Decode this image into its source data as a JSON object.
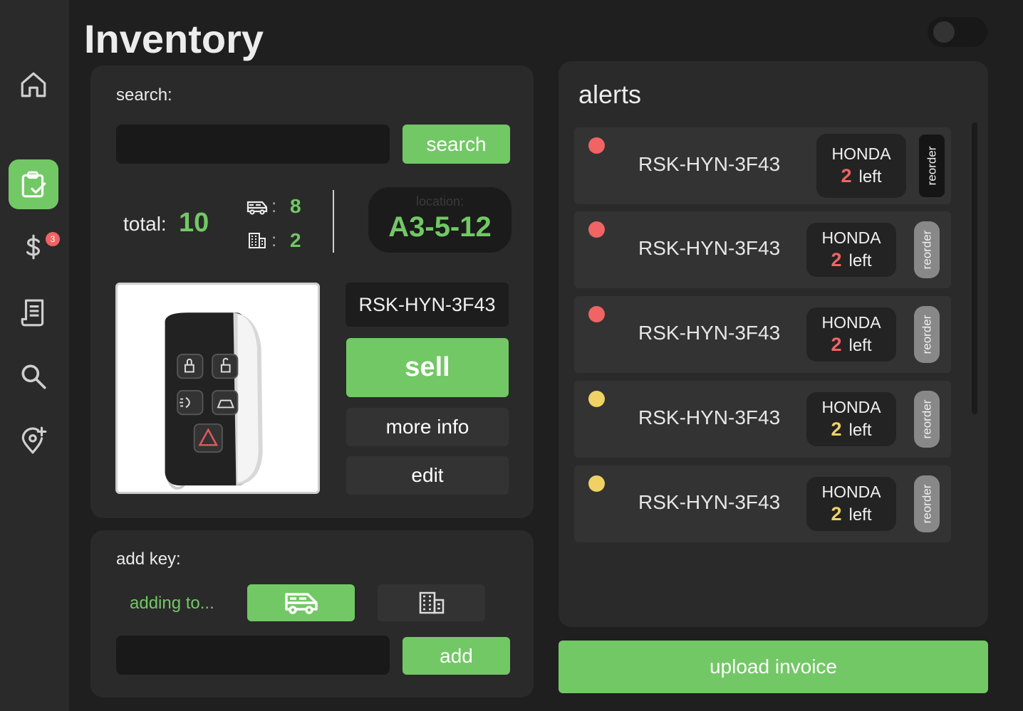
{
  "app": {
    "title": "Inventory"
  },
  "sidebar": {
    "items": [
      {
        "name": "home",
        "icon": "home-icon"
      },
      {
        "name": "inventory",
        "icon": "clipboard-check-icon",
        "active": true
      },
      {
        "name": "sales",
        "icon": "dollar-icon",
        "badge": "3"
      },
      {
        "name": "receipts",
        "icon": "receipt-icon"
      },
      {
        "name": "search",
        "icon": "search-icon"
      },
      {
        "name": "add-location",
        "icon": "location-plus-icon"
      }
    ]
  },
  "search_panel": {
    "label": "search:",
    "input_value": "",
    "button_label": "search",
    "total_label": "total:",
    "total_value": "10",
    "van_sep": ":",
    "van_count": "8",
    "building_sep": ":",
    "building_count": "2",
    "location_label": "location:",
    "location_value": "A3-5-12",
    "key_code": "RSK-HYN-3F43",
    "sell_label": "sell",
    "more_info_label": "more info",
    "edit_label": "edit"
  },
  "add_panel": {
    "label": "add key:",
    "adding_to": "adding to...",
    "input_value": "",
    "add_label": "add"
  },
  "alerts": {
    "title": "alerts",
    "items": [
      {
        "code": "RSK-HYN-3F43",
        "brand": "HONDA",
        "count": "2",
        "left": "left",
        "level": "red",
        "reorder": "reorder",
        "reorder_style": "dark"
      },
      {
        "code": "RSK-HYN-3F43",
        "brand": "HONDA",
        "count": "2",
        "left": "left",
        "level": "red",
        "reorder": "reorder",
        "reorder_style": "grey"
      },
      {
        "code": "RSK-HYN-3F43",
        "brand": "HONDA",
        "count": "2",
        "left": "left",
        "level": "red",
        "reorder": "reorder",
        "reorder_style": "grey"
      },
      {
        "code": "RSK-HYN-3F43",
        "brand": "HONDA",
        "count": "2",
        "left": "left",
        "level": "yellow",
        "reorder": "reorder",
        "reorder_style": "grey"
      },
      {
        "code": "RSK-HYN-3F43",
        "brand": "HONDA",
        "count": "2",
        "left": "left",
        "level": "yellow",
        "reorder": "reorder",
        "reorder_style": "grey"
      }
    ]
  },
  "upload_label": "upload invoice",
  "colors": {
    "accent": "#72c865",
    "alert_red": "#f06464",
    "alert_yellow": "#f0d264",
    "background": "#1f1f1f",
    "panel": "#2a2a2a"
  }
}
